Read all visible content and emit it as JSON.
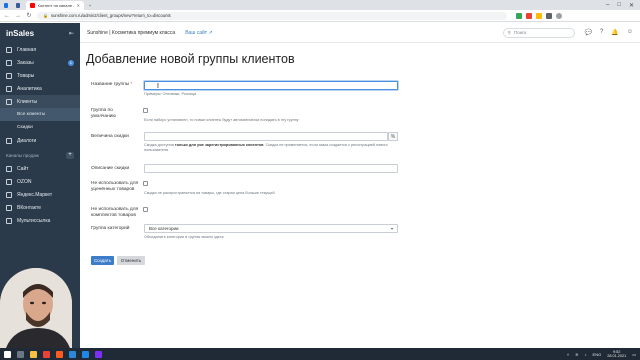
{
  "browser": {
    "tab_active": "Контент на канале - YouTube Studio",
    "url": "sunshine.com.ru/admin2/client_groups/new?return_to=discounts",
    "colors": {
      "tab_bar": "#dee1e6",
      "address_bg": "#f1f3f4"
    }
  },
  "sidebar": {
    "logo": "inSales",
    "items": [
      {
        "label": "Главная",
        "icon": "home-icon"
      },
      {
        "label": "Заказы",
        "icon": "orders-icon",
        "badge": "1"
      },
      {
        "label": "Товары",
        "icon": "products-icon"
      },
      {
        "label": "Аналитика",
        "icon": "analytics-icon"
      },
      {
        "label": "Клиенты",
        "icon": "clients-icon",
        "active": true
      },
      {
        "label": "Все клиенты",
        "sub": true,
        "active": true
      },
      {
        "label": "Скидки",
        "sub": true
      },
      {
        "label": "Диалоги",
        "icon": "dialogs-icon"
      }
    ],
    "channels_label": "Каналы продаж",
    "channels": [
      {
        "label": "Сайт",
        "icon": "site-icon"
      },
      {
        "label": "OZON",
        "icon": "ozon-icon"
      },
      {
        "label": "Яндекс.Маркет",
        "icon": "yandex-market-icon"
      },
      {
        "label": "ВКонтакте",
        "icon": "vk-icon"
      },
      {
        "label": "Мультиссылка",
        "icon": "multilink-icon"
      }
    ],
    "colors": {
      "bg": "#2b3a4a",
      "active": "#3a4b5d"
    }
  },
  "topbar": {
    "shop_name": "Sunshine | Косметика премиум класса",
    "site_link": "Ваш сайт",
    "search_placeholder": "Поиск"
  },
  "form": {
    "title": "Добавление новой группы клиентов",
    "name_label": "Название группы",
    "name_required": "*",
    "name_hint": "Примеры: Оптовики, Розница",
    "default_label": "Группа по умолчанию",
    "default_hint": "Если наборс установлен, то новые клиенты будут автоматически попадать в эту группу",
    "discount_label": "Величина скидки",
    "discount_hint_pre": "Скидка доступна ",
    "discount_hint_bold": "только для уже зарегистрированных клиентов",
    "discount_hint_post": ". Скидка не применяется, если заказ создается с регистрацией нового пользователя",
    "description_label": "Описание скидки",
    "no_discounted_label": "Не использовать для уценённых товаров",
    "no_discounted_hint": "Скидка не распространяется на товары, где старая цена больше текущей",
    "no_bundles_label": "Не использовать для комплектов товаров",
    "category_group_label": "Группа категорий",
    "category_group_value": "Все категории",
    "category_group_hint": "Объединить категории в группы можно здесь",
    "save_button": "Создать",
    "cancel_button": "Отменить",
    "colors": {
      "primary": "#3d7cc9",
      "focus": "#4a90e2"
    }
  },
  "taskbar": {
    "time": "9:52",
    "date": "28.01.2021",
    "lang": "ENG"
  }
}
